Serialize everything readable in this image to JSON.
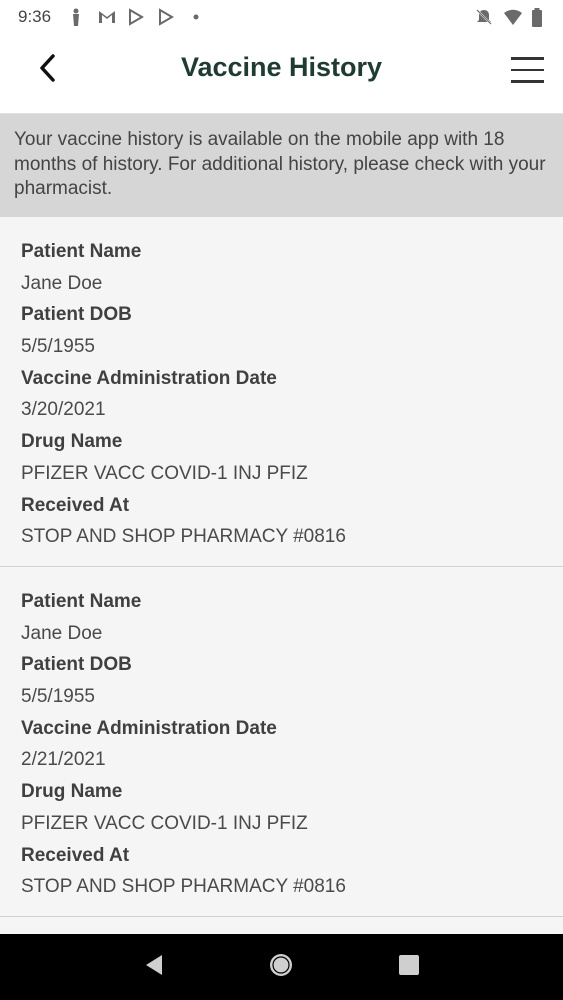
{
  "status_bar": {
    "time": "9:36",
    "icons": [
      "accessibility-icon",
      "gmail-icon",
      "play-store-icon",
      "play-store-icon",
      "dot-icon",
      "do-not-disturb-icon",
      "wifi-icon",
      "battery-icon"
    ]
  },
  "header": {
    "title": "Vaccine History",
    "back_icon": "chevron-left-icon",
    "menu_icon": "hamburger-menu-icon"
  },
  "notice": {
    "text": "Your vaccine history is available on the mobile app with 18 months of history. For additional history, please check with your pharmacist."
  },
  "records": [
    {
      "patient_name_label": "Patient Name",
      "patient_name": "Jane Doe",
      "patient_dob_label": "Patient DOB",
      "patient_dob": "5/5/1955",
      "admin_date_label": "Vaccine Administration Date",
      "admin_date": "3/20/2021",
      "drug_name_label": "Drug Name",
      "drug_name": "PFIZER VACC COVID-1 INJ PFIZ",
      "received_at_label": "Received At",
      "received_at": "STOP AND SHOP PHARMACY #0816"
    },
    {
      "patient_name_label": "Patient Name",
      "patient_name": "Jane Doe",
      "patient_dob_label": "Patient DOB",
      "patient_dob": "5/5/1955",
      "admin_date_label": "Vaccine Administration Date",
      "admin_date": "2/21/2021",
      "drug_name_label": "Drug Name",
      "drug_name": "PFIZER VACC COVID-1 INJ PFIZ",
      "received_at_label": "Received At",
      "received_at": "STOP AND SHOP PHARMACY #0816"
    }
  ],
  "colors": {
    "title": "#1f3b33",
    "notice_bg": "#d6d6d6",
    "page_bg": "#f5f5f5",
    "navbar_bg": "#000000"
  }
}
